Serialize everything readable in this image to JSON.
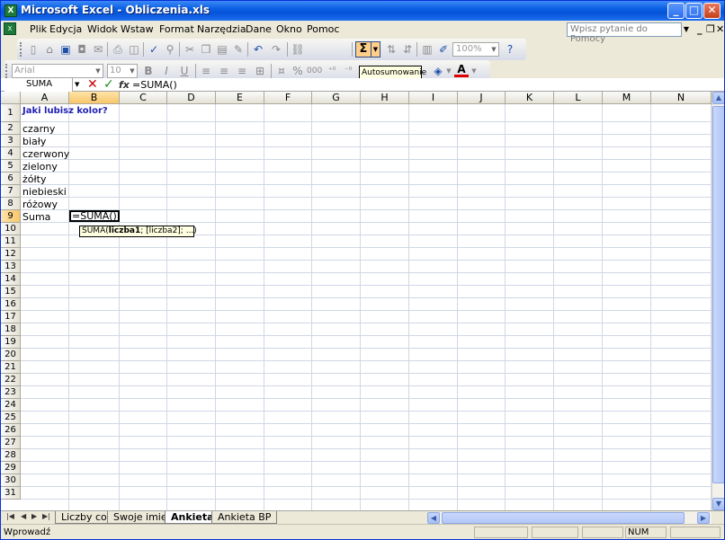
{
  "window": {
    "title": "Microsoft Excel - Obliczenia.xls",
    "app_icon": "X",
    "controls": {
      "minimize": "_",
      "maximize": "□",
      "close": "✕"
    }
  },
  "menubar": {
    "items": [
      "Plik",
      "Edycja",
      "Widok",
      "Wstaw",
      "Format",
      "Narzędzia",
      "Dane",
      "Okno",
      "Pomoc"
    ],
    "help_placeholder": "Wpisz pytanie do Pomocy",
    "mdi": {
      "minimize": "_",
      "restore": "❐",
      "close": "✕"
    }
  },
  "standard_toolbar": {
    "zoom": "100%",
    "autosum_symbol": "Σ",
    "tooltip": "Autosumowanie"
  },
  "format_toolbar": {
    "font": "Arial",
    "size": "10",
    "bold": "B",
    "italic": "I",
    "underline": "U",
    "percent": "%",
    "thousands": "000"
  },
  "formula_bar": {
    "name_box": "SUMA",
    "cancel": "✕",
    "enter": "✓",
    "fx": "fx",
    "content": "=SUMA()"
  },
  "grid": {
    "columns": [
      "A",
      "B",
      "C",
      "D",
      "E",
      "F",
      "G",
      "H",
      "I",
      "J",
      "K",
      "L",
      "M",
      "N"
    ],
    "rows": [
      "1",
      "2",
      "3",
      "4",
      "5",
      "6",
      "7",
      "8",
      "9",
      "10",
      "11",
      "12",
      "13",
      "14",
      "15",
      "16",
      "17",
      "18",
      "19",
      "20",
      "21",
      "22",
      "23",
      "24",
      "25",
      "26",
      "27",
      "28",
      "29",
      "30",
      "31"
    ],
    "selected_column": "B",
    "selected_row": "9",
    "cells": {
      "A1": "Jaki lubisz kolor?",
      "A2": "czarny",
      "A3": "biały",
      "A4": "czerwony",
      "A5": "zielony",
      "A6": "żółty",
      "A7": "niebieski",
      "A8": "różowy",
      "A9": "Suma"
    },
    "active_cell_value": "=SUMA()",
    "function_tip": {
      "prefix": "SUMA(",
      "bold_arg": "liczba1",
      "rest": "; [liczba2]; ...)"
    }
  },
  "sheet_tabs": [
    "Liczby co",
    "Swoje imię",
    "Ankieta",
    "Ankieta BP"
  ],
  "active_sheet": "Ankieta",
  "status": {
    "mode": "Wprowadź",
    "num": "NUM"
  },
  "colors": {
    "titlebar": "#0a5fe3",
    "header_selected": "#f7c66b",
    "a1_text": "#1f1fb4"
  }
}
